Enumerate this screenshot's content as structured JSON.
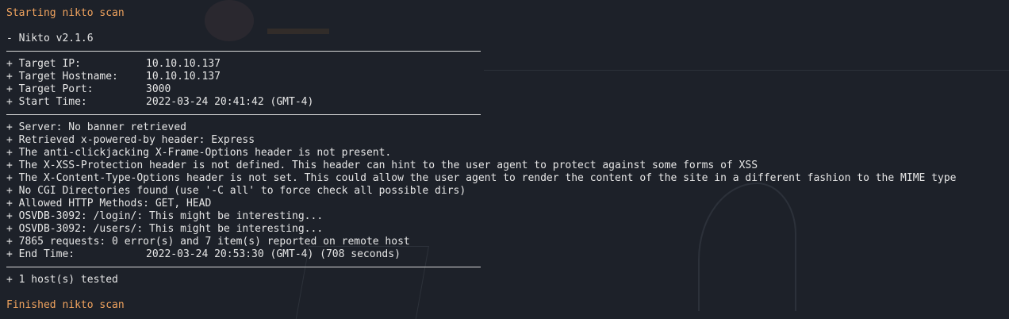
{
  "terminal": {
    "start_msg": "Starting nikto scan",
    "version": "- Nikto v2.1.6",
    "target": [
      {
        "key": "+ Target IP:",
        "value": "10.10.10.137"
      },
      {
        "key": "+ Target Hostname:",
        "value": "10.10.10.137"
      },
      {
        "key": "+ Target Port:",
        "value": "3000"
      },
      {
        "key": "+ Start Time:",
        "value": "2022-03-24 20:41:42 (GMT-4)"
      }
    ],
    "findings": [
      "+ Server: No banner retrieved",
      "+ Retrieved x-powered-by header: Express",
      "+ The anti-clickjacking X-Frame-Options header is not present.",
      "+ The X-XSS-Protection header is not defined. This header can hint to the user agent to protect against some forms of XSS",
      "+ The X-Content-Type-Options header is not set. This could allow the user agent to render the content of the site in a different fashion to the MIME type",
      "+ No CGI Directories found (use '-C all' to force check all possible dirs)",
      "+ Allowed HTTP Methods: GET, HEAD",
      "+ OSVDB-3092: /login/: This might be interesting...",
      "+ OSVDB-3092: /users/: This might be interesting...",
      "+ 7865 requests: 0 error(s) and 7 item(s) reported on remote host"
    ],
    "end_time": {
      "key": "+ End Time:",
      "value": "2022-03-24 20:53:30 (GMT-4) (708 seconds)"
    },
    "hosts_tested": "+ 1 host(s) tested",
    "finish_msg": "Finished nikto scan"
  },
  "colors": {
    "background": "#1d2129",
    "text": "#e6e6e6",
    "accent": "#f0a35e"
  }
}
